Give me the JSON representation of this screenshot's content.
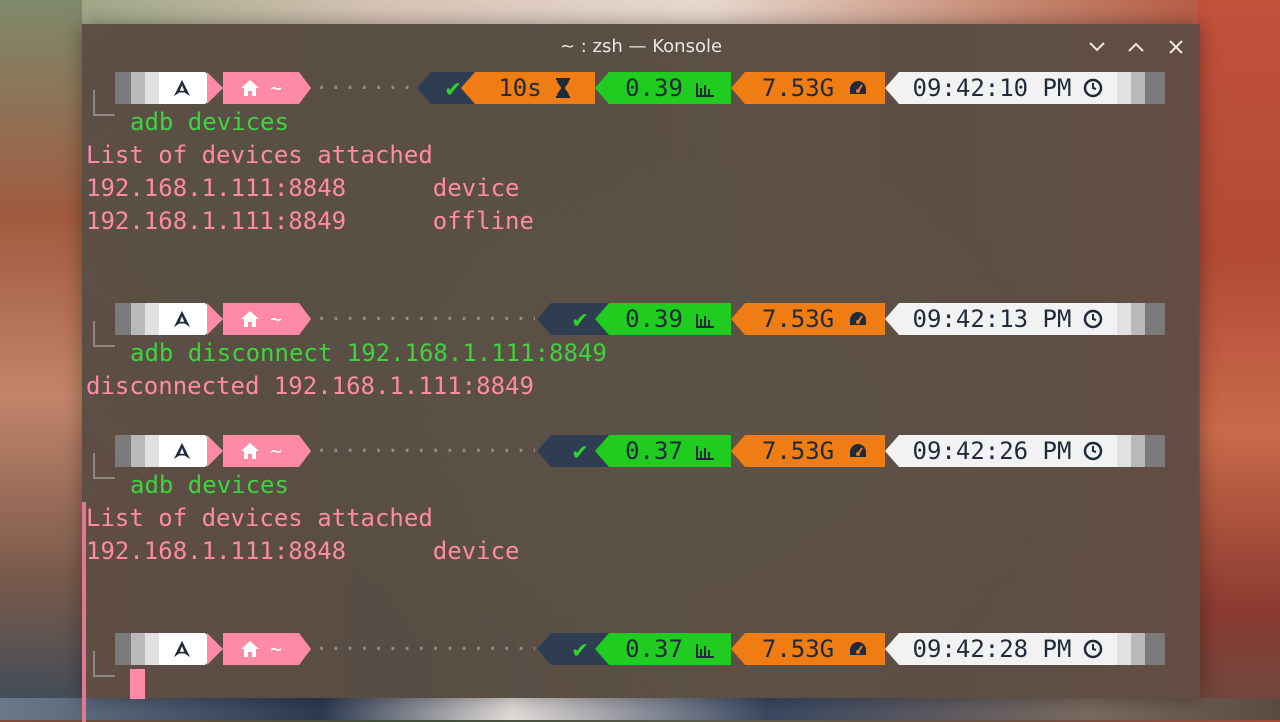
{
  "window": {
    "title": "~ : zsh — Konsole",
    "controls": [
      "minimize",
      "maximize",
      "close"
    ]
  },
  "colors": {
    "prompt_pink": "#ff8aa6",
    "command_green": "#3ed43e",
    "status_navy": "#2f3d52",
    "status_orange": "#f07c14",
    "status_green": "#20cc20"
  },
  "prompts": [
    {
      "home": "~",
      "status_check": "✔",
      "duration": "10s",
      "load": "0.39",
      "memory": "7.53G",
      "time": "09:42:10 PM",
      "command": "adb devices",
      "output": [
        "List of devices attached",
        "192.168.1.111:8848      device",
        "192.168.1.111:8849      offline"
      ]
    },
    {
      "home": "~",
      "status_check": "✔",
      "load": "0.39",
      "memory": "7.53G",
      "time": "09:42:13 PM",
      "command": "adb disconnect 192.168.1.111:8849",
      "output": [
        "disconnected 192.168.1.111:8849"
      ]
    },
    {
      "home": "~",
      "status_check": "✔",
      "load": "0.37",
      "memory": "7.53G",
      "time": "09:42:26 PM",
      "command": "adb devices",
      "output": [
        "List of devices attached",
        "192.168.1.111:8848      device"
      ]
    },
    {
      "home": "~",
      "status_check": "✔",
      "load": "0.37",
      "memory": "7.53G",
      "time": "09:42:28 PM",
      "command": "",
      "output": []
    }
  ],
  "icons": {
    "os": "arch-linux-icon",
    "home": "home-icon",
    "duration": "hourglass-icon",
    "load": "bar-chart-icon",
    "memory": "speedometer-icon",
    "time": "clock-icon"
  }
}
